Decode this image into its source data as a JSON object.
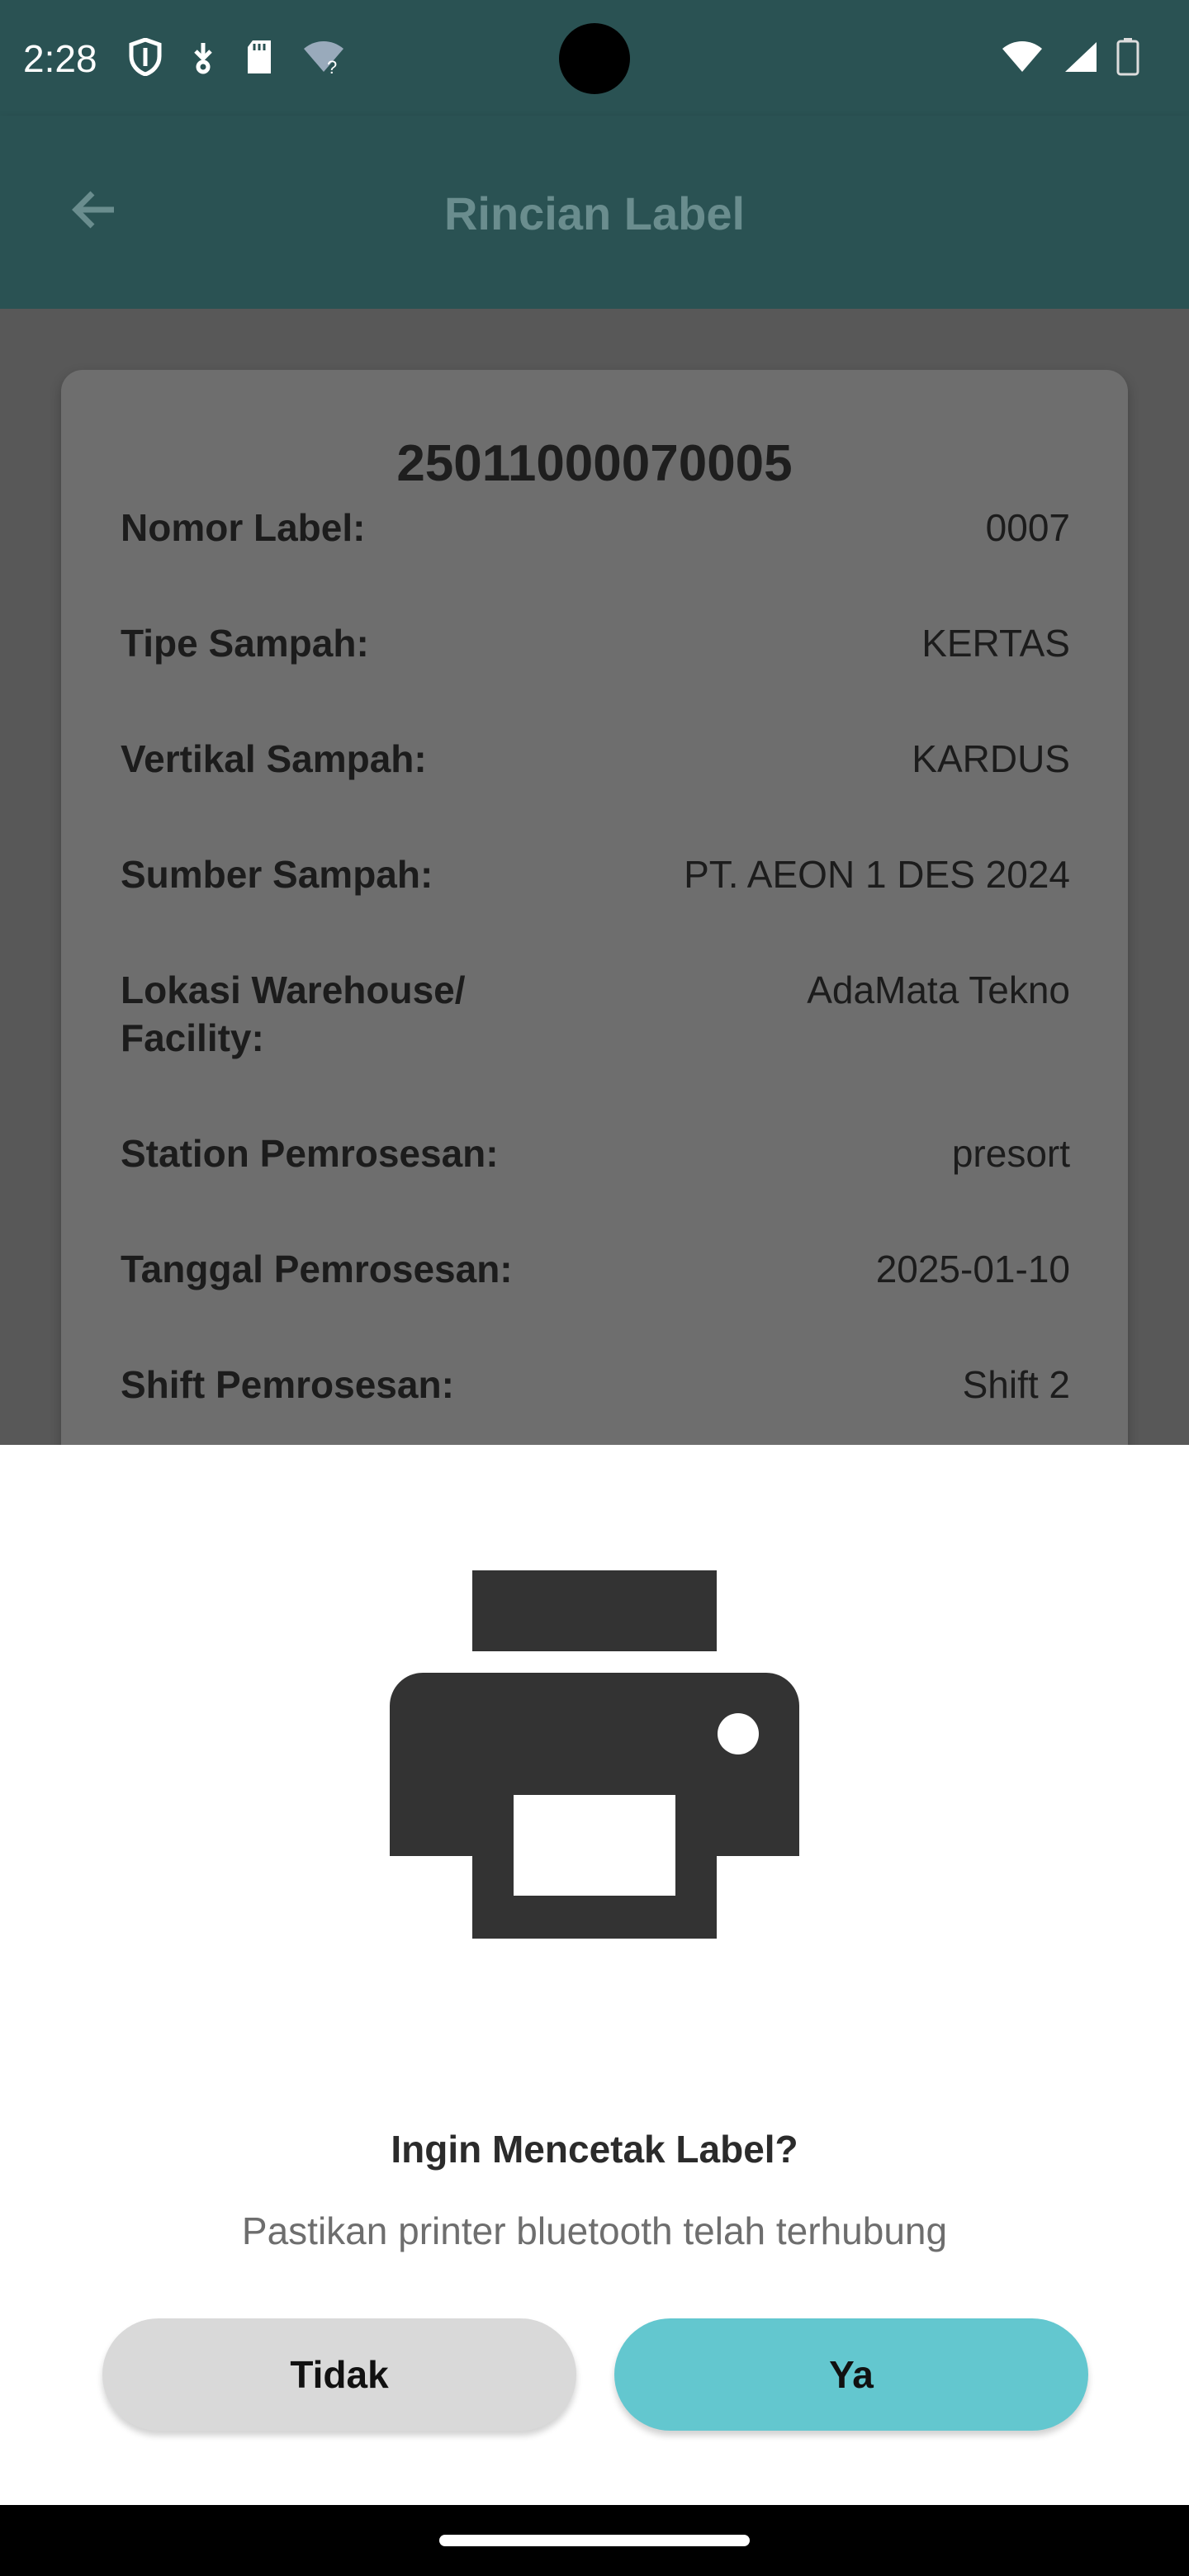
{
  "status": {
    "time": "2:28",
    "left_icons": [
      "shield-icon",
      "download-icon",
      "sd-card-icon",
      "wifi-question-icon"
    ],
    "right_icons": [
      "wifi-icon",
      "signal-icon",
      "battery-icon"
    ]
  },
  "appbar": {
    "title": "Rincian Label",
    "back_icon": "arrow-left-icon"
  },
  "card": {
    "label_number": "25011000070005",
    "rows": [
      {
        "key": "Nomor Label:",
        "value": "0007"
      },
      {
        "key": "Tipe Sampah:",
        "value": "KERTAS"
      },
      {
        "key": "Vertikal Sampah:",
        "value": "KARDUS"
      },
      {
        "key": "Sumber Sampah:",
        "value": "PT. AEON 1 DES 2024"
      },
      {
        "key": "Lokasi Warehouse/ Facility:",
        "value": "AdaMata Tekno"
      },
      {
        "key": "Station Pemrosesan:",
        "value": "presort"
      },
      {
        "key": "Tanggal Pemrosesan:",
        "value": "2025-01-10"
      },
      {
        "key": "Shift Pemrosesan:",
        "value": "Shift 2"
      }
    ]
  },
  "dialog": {
    "icon": "printer-icon",
    "title": "Ingin Mencetak Label?",
    "subtitle": "Pastikan printer bluetooth telah terhubung",
    "no_label": "Tidak",
    "yes_label": "Ya"
  },
  "colors": {
    "appbar": "#2a5253",
    "accent_button": "#63c7cf",
    "secondary_button": "#d9d9d9"
  }
}
